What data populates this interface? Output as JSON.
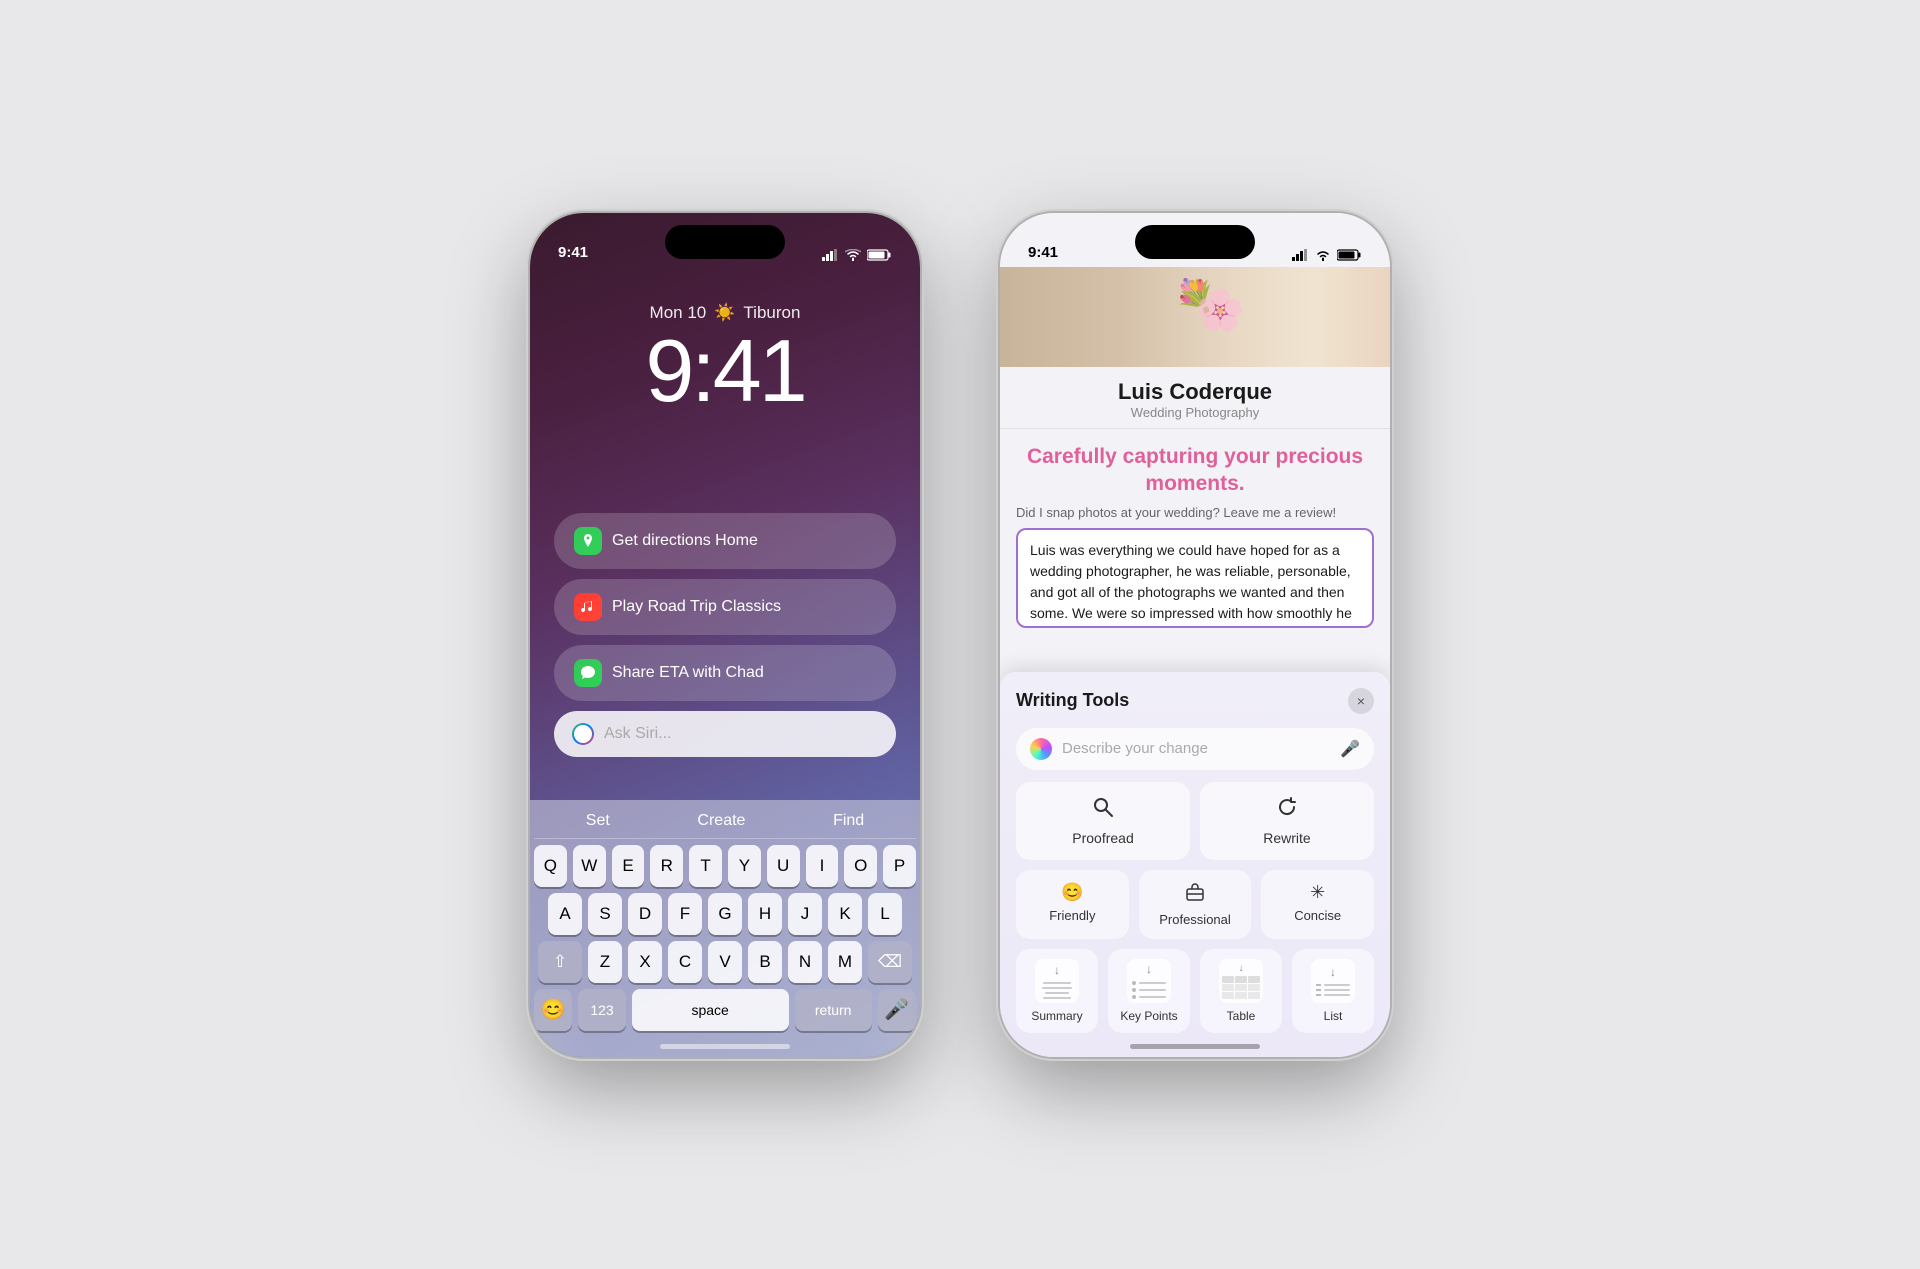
{
  "background_color": "#e8e8ea",
  "phone_left": {
    "date": "Mon 10",
    "weather": "Tiburon",
    "time": "9:41",
    "suggestions": [
      {
        "id": "directions",
        "icon": "maps",
        "label": "Get directions Home",
        "icon_emoji": "🗺"
      },
      {
        "id": "music",
        "icon": "music",
        "label": "Play Road Trip Classics",
        "icon_emoji": "🎵"
      },
      {
        "id": "messages",
        "icon": "messages",
        "label": "Share ETA with Chad",
        "icon_emoji": "💬"
      }
    ],
    "siri_placeholder": "Ask Siri...",
    "keyboard_suggestions": [
      "Set",
      "Create",
      "Find"
    ],
    "keyboard_rows": [
      [
        "Q",
        "W",
        "E",
        "R",
        "T",
        "Y",
        "U",
        "I",
        "O",
        "P"
      ],
      [
        "A",
        "S",
        "D",
        "F",
        "G",
        "H",
        "J",
        "K",
        "L"
      ],
      [
        "⇧",
        "Z",
        "X",
        "C",
        "V",
        "B",
        "N",
        "M",
        "⌫"
      ],
      [
        "123",
        "space",
        "return"
      ]
    ]
  },
  "phone_right": {
    "status_time": "9:41",
    "photographer_name": "Luis Coderque",
    "photographer_subtitle": "Wedding Photography",
    "tagline": "Carefully capturing your precious moments.",
    "review_prompt": "Did I snap photos at your wedding? Leave me a review!",
    "review_text": "Luis was everything we could have hoped for as a wedding photographer, he was reliable, personable, and got all of the photographs we wanted and then some. We were so impressed with how smoothly he circulated through our ceremony and reception. We barely realized he was there except when he was very",
    "writing_tools": {
      "title": "Writing Tools",
      "close": "×",
      "describe_placeholder": "Describe your change",
      "tools": [
        {
          "id": "proofread",
          "label": "Proofread",
          "icon": "search"
        },
        {
          "id": "rewrite",
          "label": "Rewrite",
          "icon": "refresh"
        }
      ],
      "tone_tools": [
        {
          "id": "friendly",
          "label": "Friendly",
          "icon": "😊"
        },
        {
          "id": "professional",
          "label": "Professional",
          "icon": "💼"
        },
        {
          "id": "concise",
          "label": "Concise",
          "icon": "✳"
        }
      ],
      "format_tools": [
        {
          "id": "summary",
          "label": "Summary"
        },
        {
          "id": "key-points",
          "label": "Key Points"
        },
        {
          "id": "table",
          "label": "Table"
        },
        {
          "id": "list",
          "label": "List"
        }
      ]
    }
  }
}
